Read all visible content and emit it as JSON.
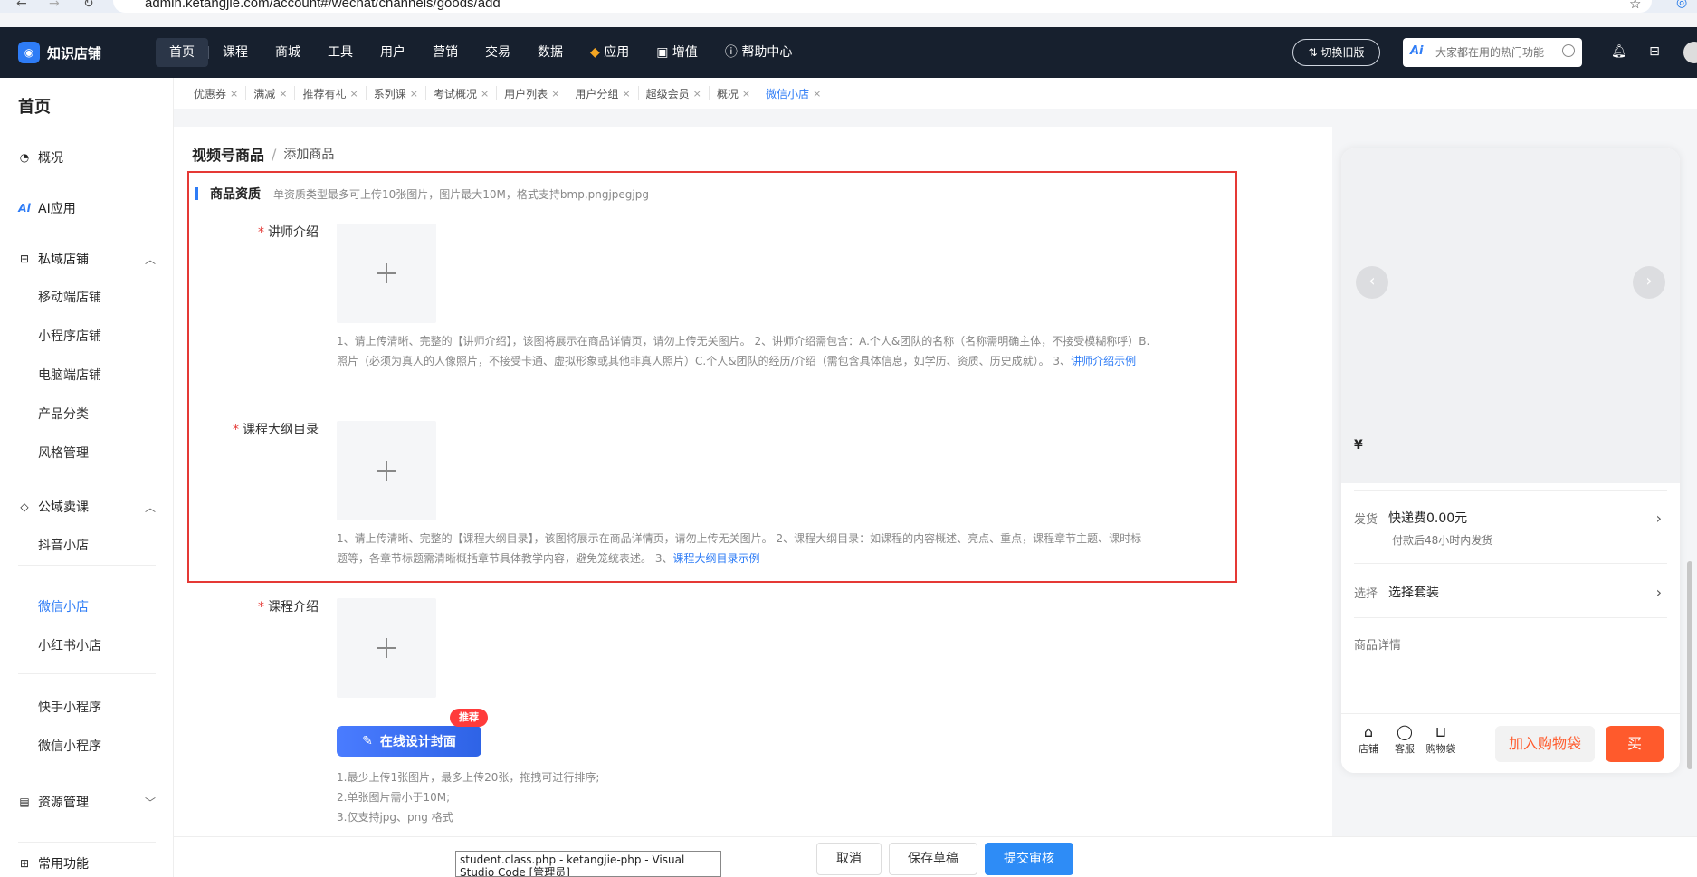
{
  "browser": {
    "back_icon": "arrow-left-icon",
    "url": "admin.ketangjie.com/account#/wechat/channels/goods/add"
  },
  "topnav": {
    "logo_text": "知识店铺",
    "items": [
      {
        "label": "首页",
        "active": true
      },
      {
        "label": "课程"
      },
      {
        "label": "商城"
      },
      {
        "label": "工具"
      },
      {
        "label": "用户"
      },
      {
        "label": "营销"
      },
      {
        "label": "交易"
      },
      {
        "label": "数据"
      },
      {
        "label": "应用"
      },
      {
        "label": "增值"
      },
      {
        "label": "帮助中心"
      }
    ],
    "switch_label": "切换旧版",
    "search_ai": "Ai",
    "search_placeholder": "大家都在用的热门功能"
  },
  "sidebar": {
    "title": "首页",
    "overview": "概况",
    "ai_app": "AI应用",
    "private_store": "私域店铺",
    "private_items": [
      "移动端店铺",
      "小程序店铺",
      "电脑端店铺",
      "产品分类",
      "风格管理"
    ],
    "public_course": "公域卖课",
    "public_items": [
      "抖音小店",
      "微信小店",
      "小红书小店"
    ],
    "mini_items": [
      "快手小程序",
      "微信小程序"
    ],
    "resource": "资源管理",
    "common": "常用功能"
  },
  "tabs": [
    {
      "label": "优惠券"
    },
    {
      "label": "满减"
    },
    {
      "label": "推荐有礼"
    },
    {
      "label": "系列课"
    },
    {
      "label": "考试概况"
    },
    {
      "label": "用户列表"
    },
    {
      "label": "用户分组"
    },
    {
      "label": "超级会员"
    },
    {
      "label": "概况"
    },
    {
      "label": "微信小店",
      "active": true
    }
  ],
  "main": {
    "breadcrumb_root": "视频号商品",
    "breadcrumb_sep": "/",
    "breadcrumb_current": "添加商品",
    "section_title": "商品资质",
    "section_hint": "单资质类型最多可上传10张图片，图片最大10M，格式支持bmp,pngjpegjpg",
    "teacher_label": "讲师介绍",
    "teacher_tip": "1、请上传清晰、完整的【讲师介绍】，该图将展示在商品详情页，请勿上传无关图片。 2、讲师介绍需包含：A.个人&团队的名称（名称需明确主体，不接受模糊称呼）B.照片（必须为真人的人像照片，不接受卡通、虚拟形象或其他非真人照片）C.个人&团队的经历/介绍（需包含具体信息，如学历、资质、历史成就）。 3、",
    "teacher_link": "讲师介绍示例",
    "outline_label": "课程大纲目录",
    "outline_tip": "1、请上传清晰、完整的【课程大纲目录】，该图将展示在商品详情页，请勿上传无关图片。 2、课程大纲目录：如课程的内容概述、亮点、重点，课程章节主题、课时标题等，各章节标题需清晰概括章节具体教学内容，避免笼统表述。 3、",
    "outline_link": "课程大纲目录示例",
    "intro_label": "课程介绍",
    "design_btn": "在线设计封面",
    "design_badge": "推荐",
    "rules": [
      "1.最少上传1张图片，最多上传20张，拖拽可进行排序;",
      "2.单张图片需小于10M;",
      "3.仅支持jpg、png 格式"
    ]
  },
  "bottom": {
    "cancel": "取消",
    "draft": "保存草稿",
    "submit": "提交审核",
    "taskbar_tip": "student.class.php - ketangjie-php - Visual Studio Code [管理员]"
  },
  "preview": {
    "price_symbol": "¥",
    "ship_label": "发货",
    "ship_value": "快递费0.00元",
    "ship_sub": "付款后48小时内发货",
    "select_label": "选择",
    "select_value": "选择套装",
    "detail_label": "商品详情",
    "foot_store": "店铺",
    "foot_service": "客服",
    "foot_bag": "购物袋",
    "add_cart": "加入购物袋",
    "buy": "买"
  }
}
